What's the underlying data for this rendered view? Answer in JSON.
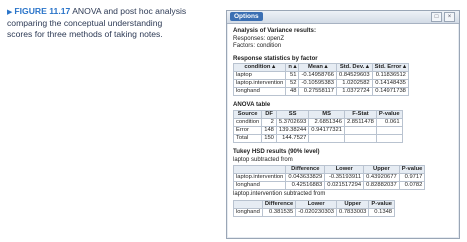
{
  "caption": {
    "prefix": "FIGURE 11.17",
    "text": "ANOVA and post hoc analysis comparing the conceptual understanding scores for three methods of taking notes."
  },
  "window": {
    "tab_label": "Options",
    "btn_a": "□",
    "btn_b": "×"
  },
  "anova": {
    "title": "Analysis of Variance results:",
    "responses": "Responses: openZ",
    "factors": "Factors: condition",
    "resp_heading": "Response statistics by factor",
    "resp_headers": [
      "condition ▴",
      "n ▴",
      "Mean ▴",
      "Std. Dev. ▴",
      "Std. Error ▴"
    ],
    "resp_rows": [
      [
        "laptop",
        "51",
        "-0.14958766",
        "0.84529603",
        "0.11836512"
      ],
      [
        "laptop.intervention",
        "52",
        "-0.10595383",
        "1.0202582",
        "0.14148435"
      ],
      [
        "longhand",
        "48",
        "0.27558117",
        "1.0372724",
        "0.14971738"
      ]
    ],
    "table_heading": "ANOVA table",
    "table_headers": [
      "Source",
      "DF",
      "SS",
      "MS",
      "F-Stat",
      "P-value"
    ],
    "table_rows": [
      [
        "condition",
        "2",
        "5.3702693",
        "2.6851346",
        "2.8511478",
        "0.061"
      ],
      [
        "Error",
        "148",
        "139.38244",
        "0.94177321",
        "",
        ""
      ],
      [
        "Total",
        "150",
        "144.7527",
        "",
        "",
        ""
      ]
    ],
    "tukey_heading": "Tukey HSD results (90% level)",
    "tukey1_sub": "laptop subtracted from",
    "tukey1_headers": [
      "",
      "Difference",
      "Lower",
      "Upper",
      "P-value"
    ],
    "tukey1_rows": [
      [
        "laptop.intervention",
        "0.043633829",
        "-0.35193911",
        "0.43920677",
        "0.9717"
      ],
      [
        "longhand",
        "0.42516883",
        "0.021517294",
        "0.82882037",
        "0.0782"
      ]
    ],
    "tukey2_sub": "laptop.intervention subtracted from",
    "tukey2_headers": [
      "",
      "Difference",
      "Lower",
      "Upper",
      "P-value"
    ],
    "tukey2_rows": [
      [
        "longhand",
        "0.381535",
        "-0.020230303",
        "0.7833003",
        "0.1348"
      ]
    ]
  }
}
